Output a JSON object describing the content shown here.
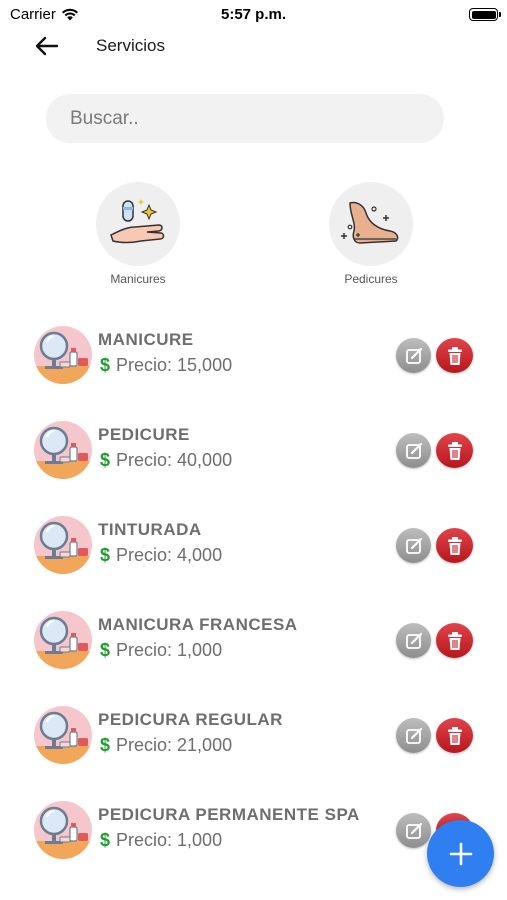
{
  "status_bar": {
    "carrier": "Carrier",
    "time": "5:57 p.m."
  },
  "nav": {
    "title": "Servicios",
    "back_icon": "arrow-left-icon"
  },
  "search": {
    "placeholder": "Buscar..",
    "value": ""
  },
  "categories": [
    {
      "label": "Manicures",
      "icon": "hand-nails-icon"
    },
    {
      "label": "Pedicures",
      "icon": "foot-icon"
    }
  ],
  "services": [
    {
      "name": "MANICURE",
      "price": "Precio: 15,000",
      "currency_symbol": "$"
    },
    {
      "name": "PEDICURE",
      "price": "Precio: 40,000",
      "currency_symbol": "$"
    },
    {
      "name": "TINTURADA",
      "price": "Precio: 4,000",
      "currency_symbol": "$"
    },
    {
      "name": "MANICURA FRANCESA",
      "price": "Precio: 1,000",
      "currency_symbol": "$"
    },
    {
      "name": "PEDICURA REGULAR",
      "price": "Precio: 21,000",
      "currency_symbol": "$"
    },
    {
      "name": "PEDICURA PERMANENTE SPA",
      "price": "Precio: 1,000",
      "currency_symbol": "$"
    }
  ],
  "fab": {
    "icon": "plus-icon"
  },
  "colors": {
    "accent": "#2f7ff0",
    "price_symbol": "#1e9c2e",
    "delete": "#c81e25",
    "edit": "#9e9e9e"
  }
}
